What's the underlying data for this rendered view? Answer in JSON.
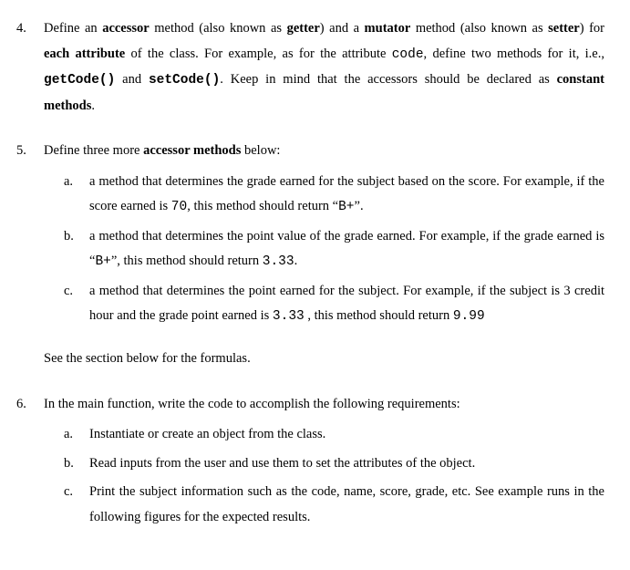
{
  "items": [
    {
      "num": "4.",
      "text": "Define an <b>accessor</b> method (also known as <b>getter</b>) and a <b>mutator</b> method (also known as <b>setter</b>) for <b>each attribute</b> of the class. For example, as for the attribute <span class='mono'>code</span>, define two methods for it, i.e., <span class='mono'><b>getCode()</b></span> and <span class='mono'><b>setCode()</b></span>. Keep in mind that the accessors should be declared as <b>constant methods</b>."
    },
    {
      "num": "5.",
      "text": "Define three more <b>accessor methods</b> below:",
      "subs": [
        {
          "n": "a.",
          "t": "a method that determines the grade earned for the subject based on the score.  For example, if the score earned is <span class='mono'>70</span>, this method should return &ldquo;<span class='mono'>B+</span>&rdquo;."
        },
        {
          "n": "b.",
          "t": "a method that determines the point value of the grade earned.  For example, if the grade earned is &ldquo;<span class='mono'>B+</span>&rdquo;, this method should return <span class='mono'>3.33</span>."
        },
        {
          "n": "c.",
          "t": "a method that determines the point earned for the subject.  For example, if the subject is 3 credit hour and the grade point earned is <span class='mono'>3.33</span> , this method should return <span class='mono'>9.99</span>"
        }
      ],
      "note": "See the section below for the formulas."
    },
    {
      "num": "6.",
      "text": "In the main function, write the code to accomplish the following requirements:",
      "subs": [
        {
          "n": "a.",
          "t": "Instantiate  or create an object from the class."
        },
        {
          "n": "b.",
          "t": "Read inputs from the user and use them to set the attributes of the object."
        },
        {
          "n": "c.",
          "t": "Print the subject information such as the code, name, score, grade, etc. See example runs in the following figures for the expected results."
        }
      ]
    }
  ]
}
